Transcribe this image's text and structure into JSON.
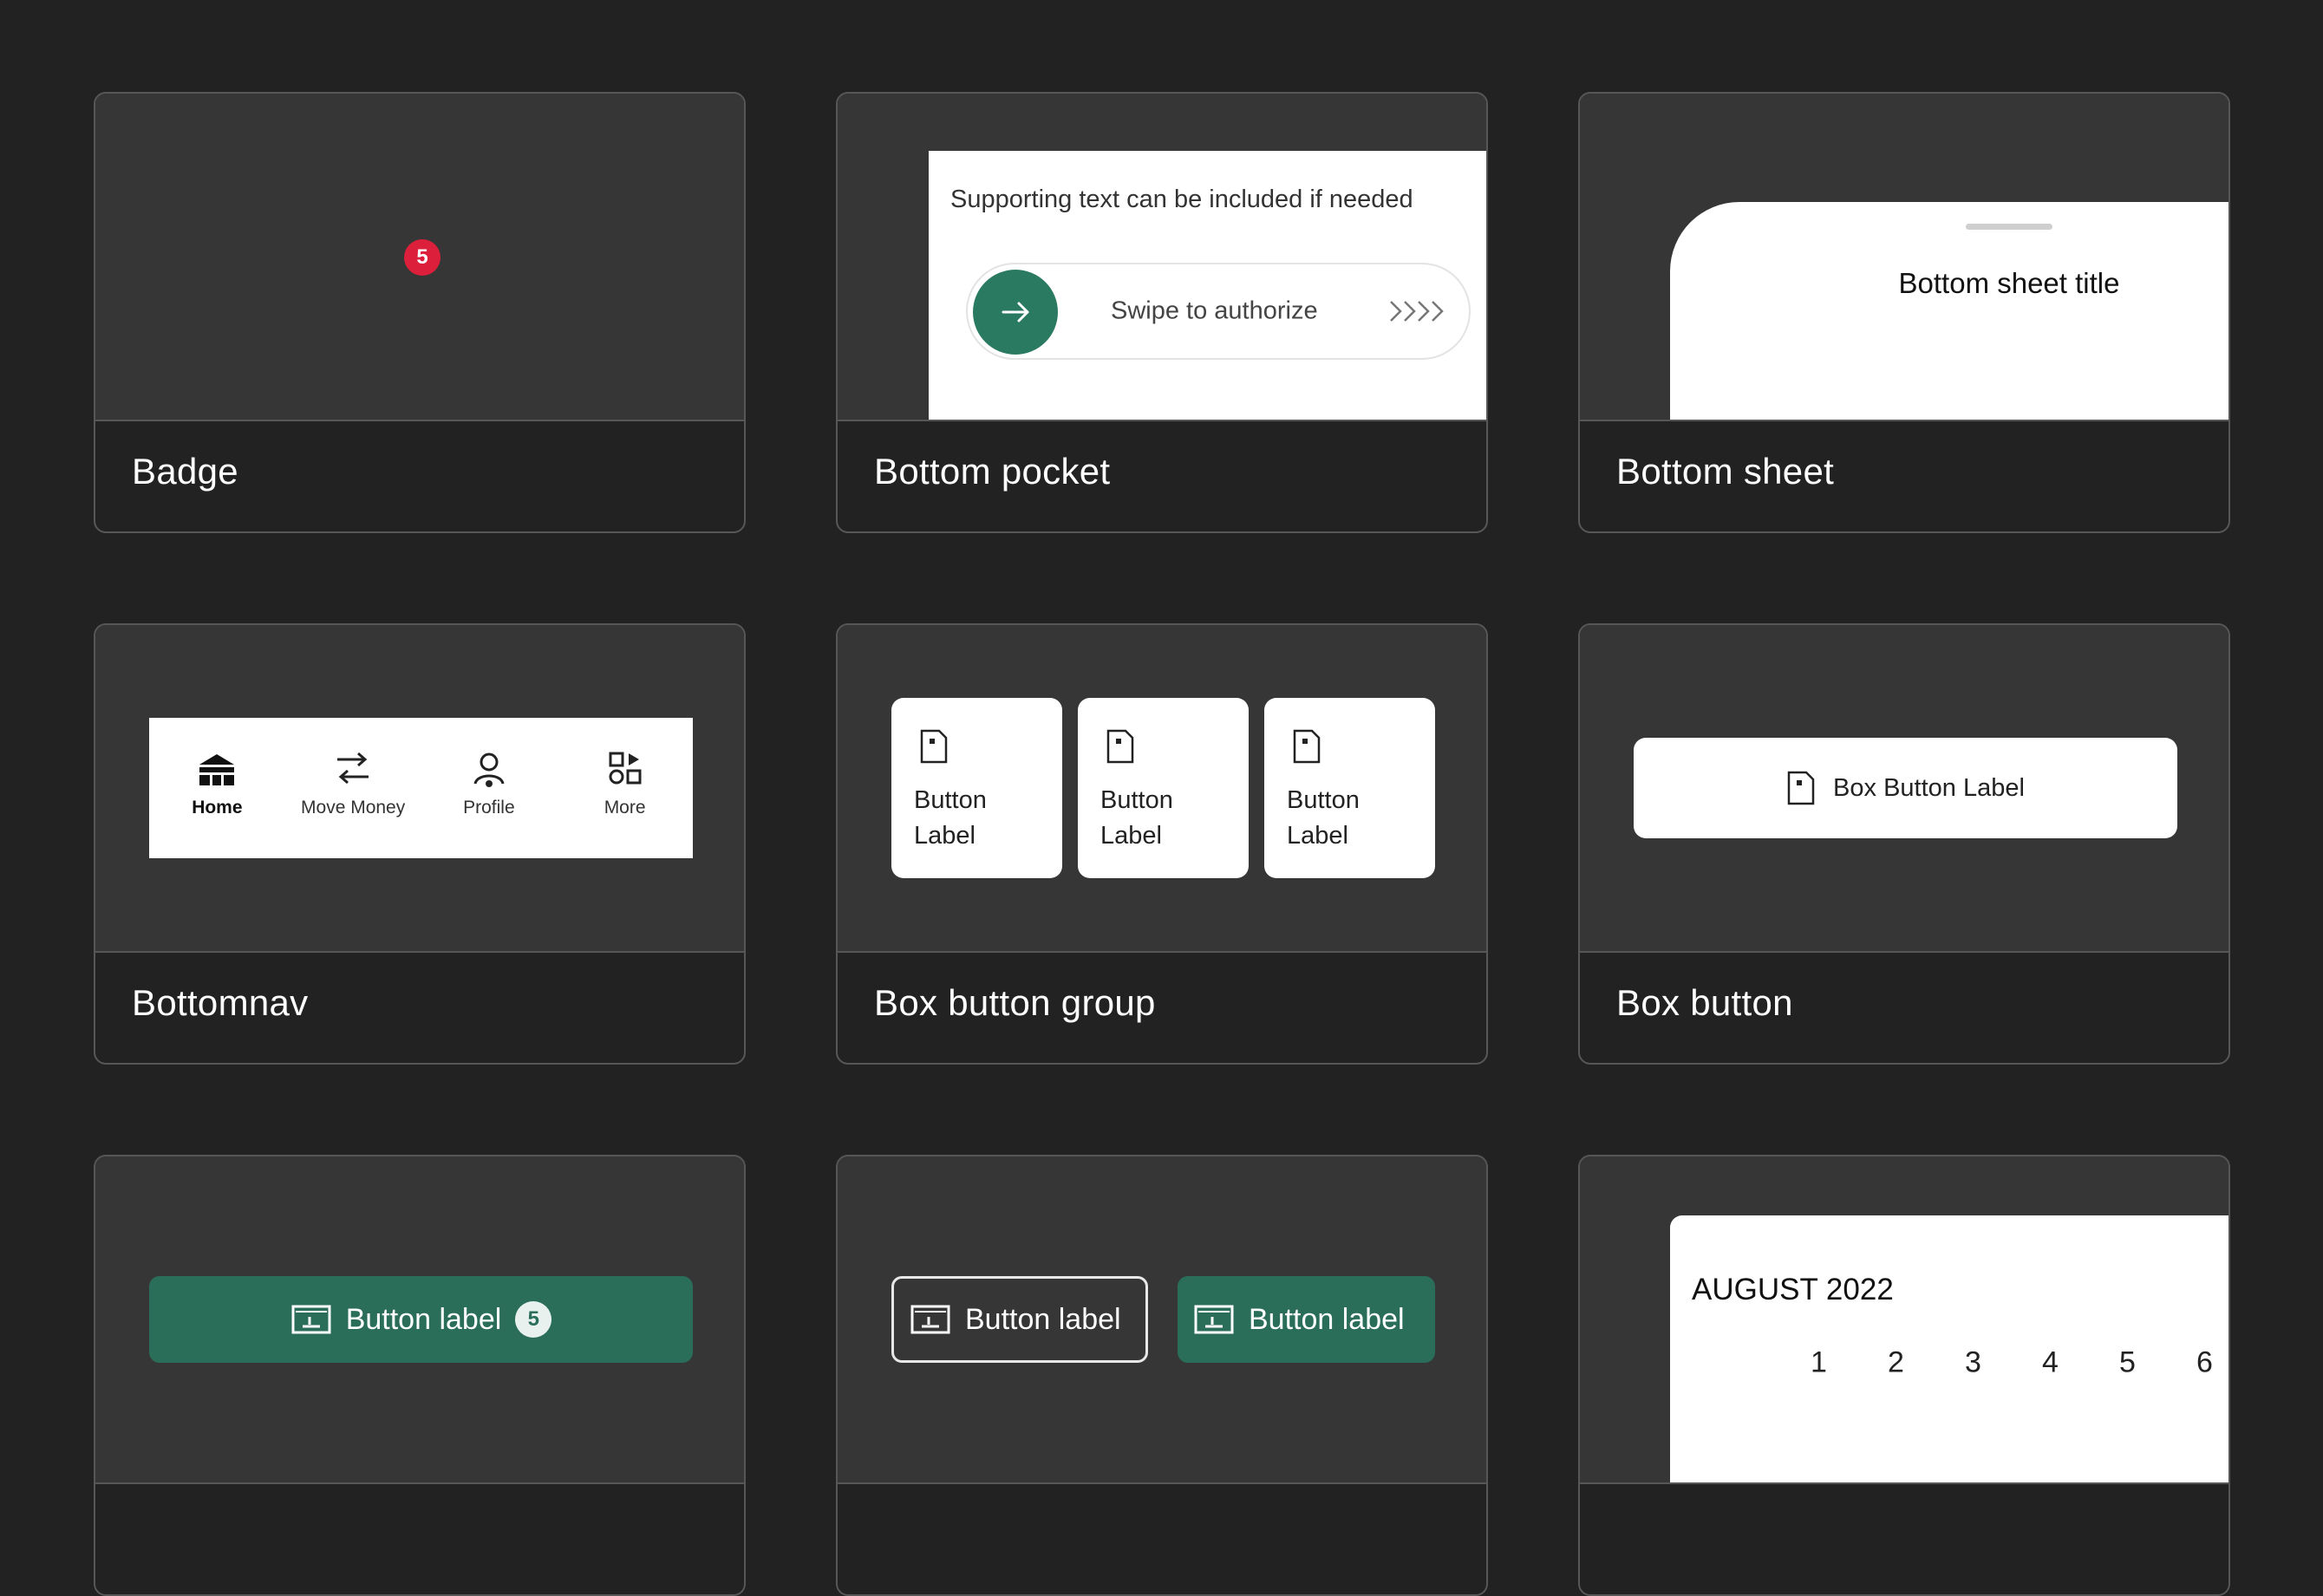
{
  "cards": {
    "badge": {
      "title": "Badge",
      "count": "5",
      "badge_color": "#dc1f3a"
    },
    "bottom_pocket": {
      "title": "Bottom pocket",
      "supporting_text": "Supporting text can be included if needed",
      "swipe_label": "Swipe to authorize",
      "chevrons": "›››",
      "accent": "#2a7a62"
    },
    "bottom_sheet": {
      "title": "Bottom sheet",
      "sheet_title": "Bottom sheet title"
    },
    "bottomnav": {
      "title": "Bottomnav",
      "items": [
        {
          "label": "Home",
          "icon": "home-icon",
          "active": true
        },
        {
          "label": "Move Money",
          "icon": "transfer-icon",
          "active": false
        },
        {
          "label": "Profile",
          "icon": "profile-icon",
          "active": false
        },
        {
          "label": "More",
          "icon": "more-icon",
          "active": false
        }
      ]
    },
    "box_button_group": {
      "title": "Box button group",
      "buttons": [
        {
          "label": "Button Label",
          "icon": "document-icon"
        },
        {
          "label": "Button Label",
          "icon": "document-icon"
        },
        {
          "label": "Button Label",
          "icon": "document-icon"
        }
      ]
    },
    "box_button": {
      "title": "Box button",
      "label": "Box Button Label",
      "icon": "document-icon"
    },
    "button_with_count": {
      "label": "Button label",
      "count": "5",
      "icon": "check-icon",
      "color": "#2a6e5a"
    },
    "button_pair": {
      "outline_label": "Button label",
      "filled_label": "Button label",
      "icon": "check-icon"
    },
    "calendar": {
      "month": "AUGUST 2022",
      "days": [
        "1",
        "2",
        "3",
        "4",
        "5",
        "6"
      ]
    }
  }
}
